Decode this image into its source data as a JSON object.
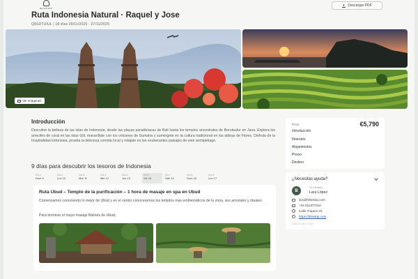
{
  "header": {
    "logo_text": "BLISSTRIP",
    "title": "Ruta Indonesia Natural · Raquel y Jose",
    "meta": "Q8SDTUIUL  |  18 días  09/11/2025 · 27/11/2025",
    "pdf_button": "Descargar PDF"
  },
  "gallery": {
    "view_images": "Ver imágenes"
  },
  "intro": {
    "heading": "Introducción",
    "text": "Descubre la belleza de las islas de Indonesia, desde las playas paradisíacas de Bali hasta los templos ancestrales de Borobudur en Java. Explora los arrecifes de coral en las islas Gili, maravíllate con los volcanes de Sumatra y sumérgete en la cultura tradicional en las aldeas de Flores. Disfruta de la hospitalidad indonesia, prueba la deliciosa comida local y relájate en los exuberantes paisajes de este archipiélago."
  },
  "days_section": {
    "heading": "9 días para descubrir los tesoros de Indonesia",
    "active_index": 5,
    "days": [
      {
        "label": "Día 1",
        "date": "Dom 9"
      },
      {
        "label": "Día 2",
        "date": "Lun 10"
      },
      {
        "label": "Día 3",
        "date": "Mar 11"
      },
      {
        "label": "Día 4",
        "date": "Mié 12"
      },
      {
        "label": "Día 5",
        "date": "Jue 13"
      },
      {
        "label": "Día 6",
        "date": "Vie 14"
      },
      {
        "label": "Día 7",
        "date": "Sáb 15"
      },
      {
        "label": "Día 8",
        "date": "Dom 16"
      },
      {
        "label": "Día 9",
        "date": "Lun 17"
      }
    ]
  },
  "day_card": {
    "title": "Ruta Ubud – Templo de la purificación – 1 hora de masaje en spa en Ubud",
    "description": "Comenzamos conociendo lo mejor de Ubud y en el centro conoceremos los templos mas emblemáticos de la zona, sus arrozales y rituales.",
    "description2": "Para terminar el mejor masaje Balinés de Ubud."
  },
  "price_card": {
    "label": "Price",
    "value": "€5,790",
    "nav": [
      "Introducción",
      "Itinerario",
      "Alojamientos",
      "Precio",
      "Destino"
    ]
  },
  "help": {
    "title": "¿Necesitas ayuda?",
    "avatar_initial": "B",
    "agent_role": "Tu contacto",
    "agent_name": "Lara López",
    "email": "lara@blisstrip.com",
    "phone": "+34 61x3773x3",
    "address": "Calle Trajano 23",
    "website": "https://blisstrip.com",
    "footer": "AGENCIA DE VIAJES"
  },
  "colors": {
    "page_bg": "#f6f7f4",
    "card_bg": "#ffffff",
    "avatar": "#3f5b4a",
    "link": "#2a55a0"
  },
  "icons": [
    "download-icon",
    "camera-icon",
    "chevron-down-icon",
    "mail-icon",
    "phone-icon",
    "location-icon",
    "globe-icon"
  ]
}
